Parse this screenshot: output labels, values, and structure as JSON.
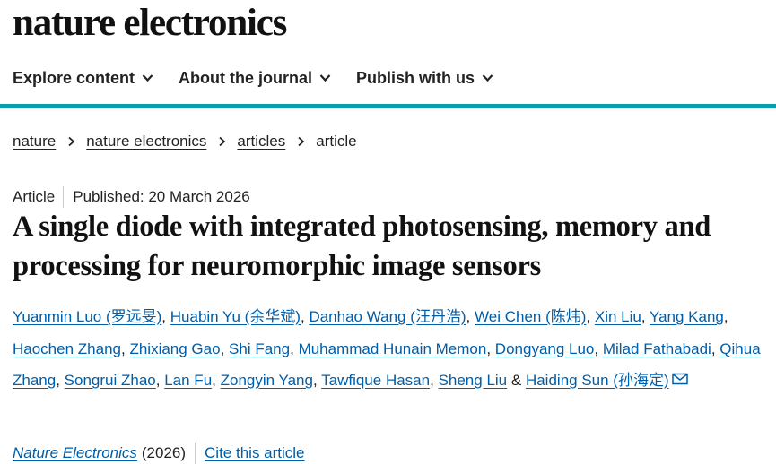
{
  "header": {
    "logo": "nature electronics"
  },
  "nav": {
    "items": [
      {
        "label": "Explore content"
      },
      {
        "label": "About the journal"
      },
      {
        "label": "Publish with us"
      }
    ]
  },
  "breadcrumb": {
    "items": [
      {
        "label": "nature"
      },
      {
        "label": "nature electronics"
      },
      {
        "label": "articles"
      },
      {
        "label": "article"
      }
    ]
  },
  "article": {
    "type": "Article",
    "published": "Published: 20 March 2026",
    "title": "A single diode with integrated photosensing, memory and processing for neuromorphic image sensors",
    "authors": [
      "Yuanmin Luo (罗远旻)",
      "Huabin Yu (余华斌)",
      "Danhao Wang (汪丹浩)",
      "Wei Chen (陈炜)",
      "Xin Liu",
      "Yang Kang",
      "Haochen Zhang",
      "Zhixiang Gao",
      "Shi Fang",
      "Muhammad Hunain Memon",
      "Dongyang Luo",
      "Milad Fathabadi",
      "Qihua Zhang",
      "Songrui Zhao",
      "Lan Fu",
      "Zongyin Yang",
      "Tawfique Hasan",
      "Sheng Liu",
      "Haiding Sun (孙海定)"
    ],
    "author_separator": ",",
    "last_separator": "&",
    "journal": "Nature Electronics",
    "year": "(2026)",
    "cite_label": "Cite this article"
  },
  "colors": {
    "accent_bar": "#069fb2",
    "link": "#005ea8",
    "text": "#222222"
  },
  "icons": {
    "nav_chevron": "chevron-down-icon",
    "breadcrumb_separator": "chevron-right-icon",
    "corresponding_author": "envelope-icon"
  }
}
